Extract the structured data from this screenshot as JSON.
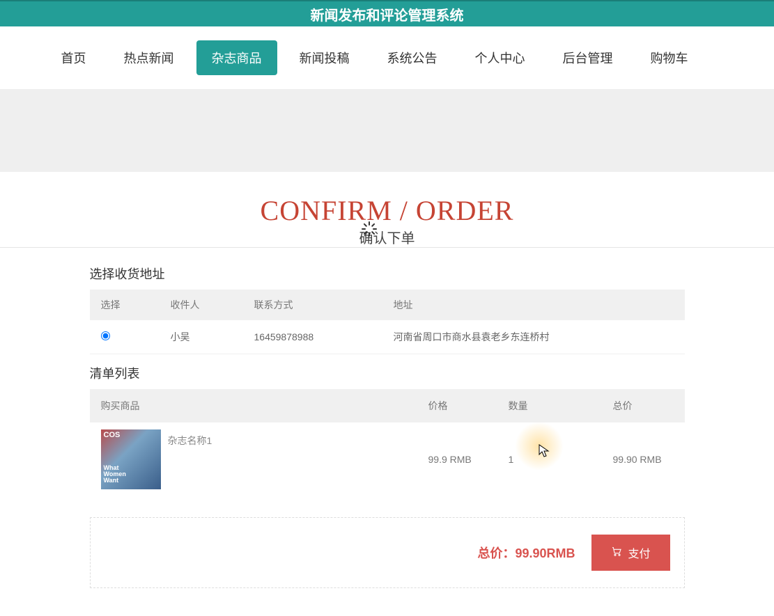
{
  "header": {
    "title": "新闻发布和评论管理系统"
  },
  "nav": {
    "items": [
      {
        "label": "首页"
      },
      {
        "label": "热点新闻"
      },
      {
        "label": "杂志商品"
      },
      {
        "label": "新闻投稿"
      },
      {
        "label": "系统公告"
      },
      {
        "label": "个人中心"
      },
      {
        "label": "后台管理"
      },
      {
        "label": "购物车"
      }
    ],
    "active_index": 2
  },
  "section": {
    "title_en": "CONFIRM / ORDER",
    "title_cn": "确认下单"
  },
  "address": {
    "block_title": "选择收货地址",
    "headers": {
      "select": "选择",
      "recipient": "收件人",
      "phone": "联系方式",
      "addr": "地址"
    },
    "rows": [
      {
        "recipient": "小吴",
        "phone": "16459878988",
        "addr": "河南省周口市商水县袁老乡东连桥村",
        "selected": true
      }
    ]
  },
  "order": {
    "block_title": "清单列表",
    "headers": {
      "product": "购买商品",
      "price": "价格",
      "qty": "数量",
      "subtotal": "总价"
    },
    "items": [
      {
        "name": "杂志名称1",
        "price": "99.9 RMB",
        "qty": "1",
        "subtotal": "99.90 RMB"
      }
    ]
  },
  "footer": {
    "total_label": "总价：",
    "total_value": "99.90RMB",
    "pay_label": "支付"
  }
}
